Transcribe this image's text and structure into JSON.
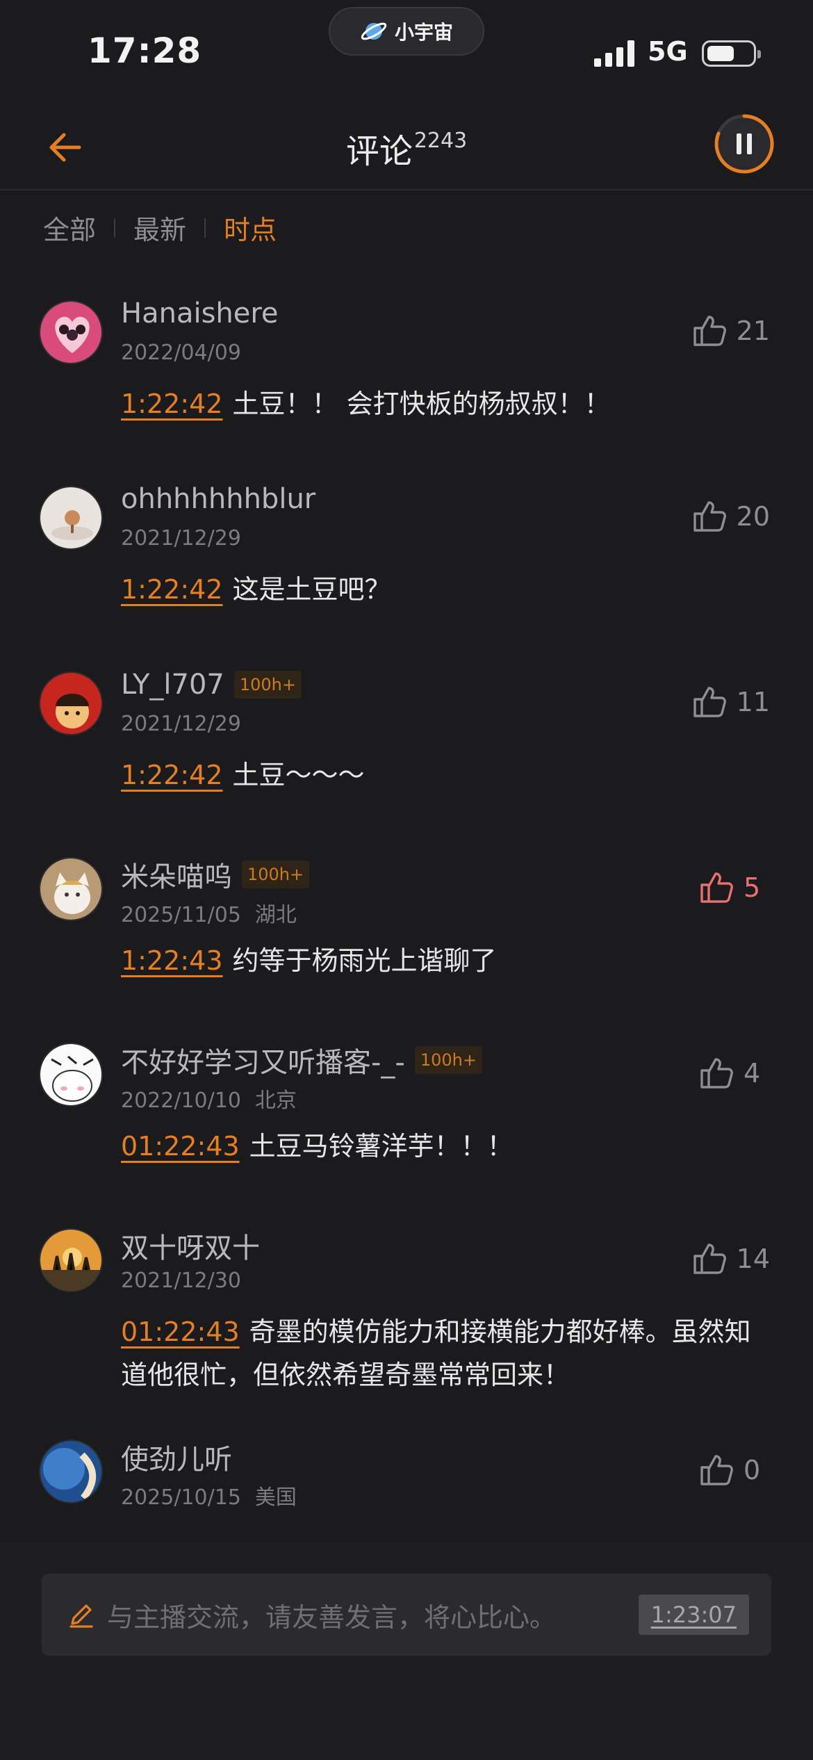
{
  "status_bar": {
    "time": "17:28",
    "island_label": "小宇宙",
    "network": "5G"
  },
  "header": {
    "title": "评论",
    "count": "2243"
  },
  "tabs": [
    {
      "label": "全部",
      "active": false
    },
    {
      "label": "最新",
      "active": false
    },
    {
      "label": "时点",
      "active": true
    }
  ],
  "comments": [
    {
      "username": "Hanaishere",
      "badge": "",
      "date": "2022/04/09",
      "location": "",
      "timestamp": "1:22:42",
      "text": "土豆！！ 会打快板的杨叔叔！！",
      "likes": "21",
      "liked": false
    },
    {
      "username": "ohhhhhhhblur",
      "badge": "",
      "date": "2021/12/29",
      "location": "",
      "timestamp": "1:22:42",
      "text": "这是土豆吧？",
      "likes": "20",
      "liked": false
    },
    {
      "username": "LY_l707",
      "badge": "100h+",
      "date": "2021/12/29",
      "location": "",
      "timestamp": "1:22:42",
      "text": "土豆～～～",
      "likes": "11",
      "liked": false
    },
    {
      "username": "米朵喵呜",
      "badge": "100h+",
      "date": "2025/11/05",
      "location": "湖北",
      "timestamp": "1:22:43",
      "text": "约等于杨雨光上谐聊了",
      "likes": "5",
      "liked": true
    },
    {
      "username": "不好好学习又听播客-_-",
      "badge": "100h+",
      "date": "2022/10/10",
      "location": "北京",
      "timestamp": "01:22:43",
      "text": "土豆马铃薯洋芋！！！",
      "likes": "4",
      "liked": false
    },
    {
      "username": "双十呀双十",
      "badge": "",
      "date": "2021/12/30",
      "location": "",
      "timestamp": "01:22:43",
      "text": "奇墨的模仿能力和接横能力都好棒。虽然知道他很忙，但依然希望奇墨常常回来！",
      "likes": "14",
      "liked": false
    },
    {
      "username": "使劲儿听",
      "badge": "",
      "date": "2025/10/15",
      "location": "美国",
      "timestamp": "",
      "text": "",
      "likes": "0",
      "liked": false
    }
  ],
  "input_bar": {
    "placeholder": "与主播交流，请友善发言，将心比心。",
    "time_chip": "1:23:07"
  },
  "colors": {
    "accent": "#e67e22",
    "liked": "#e8716f",
    "background": "#1b1b1d"
  }
}
